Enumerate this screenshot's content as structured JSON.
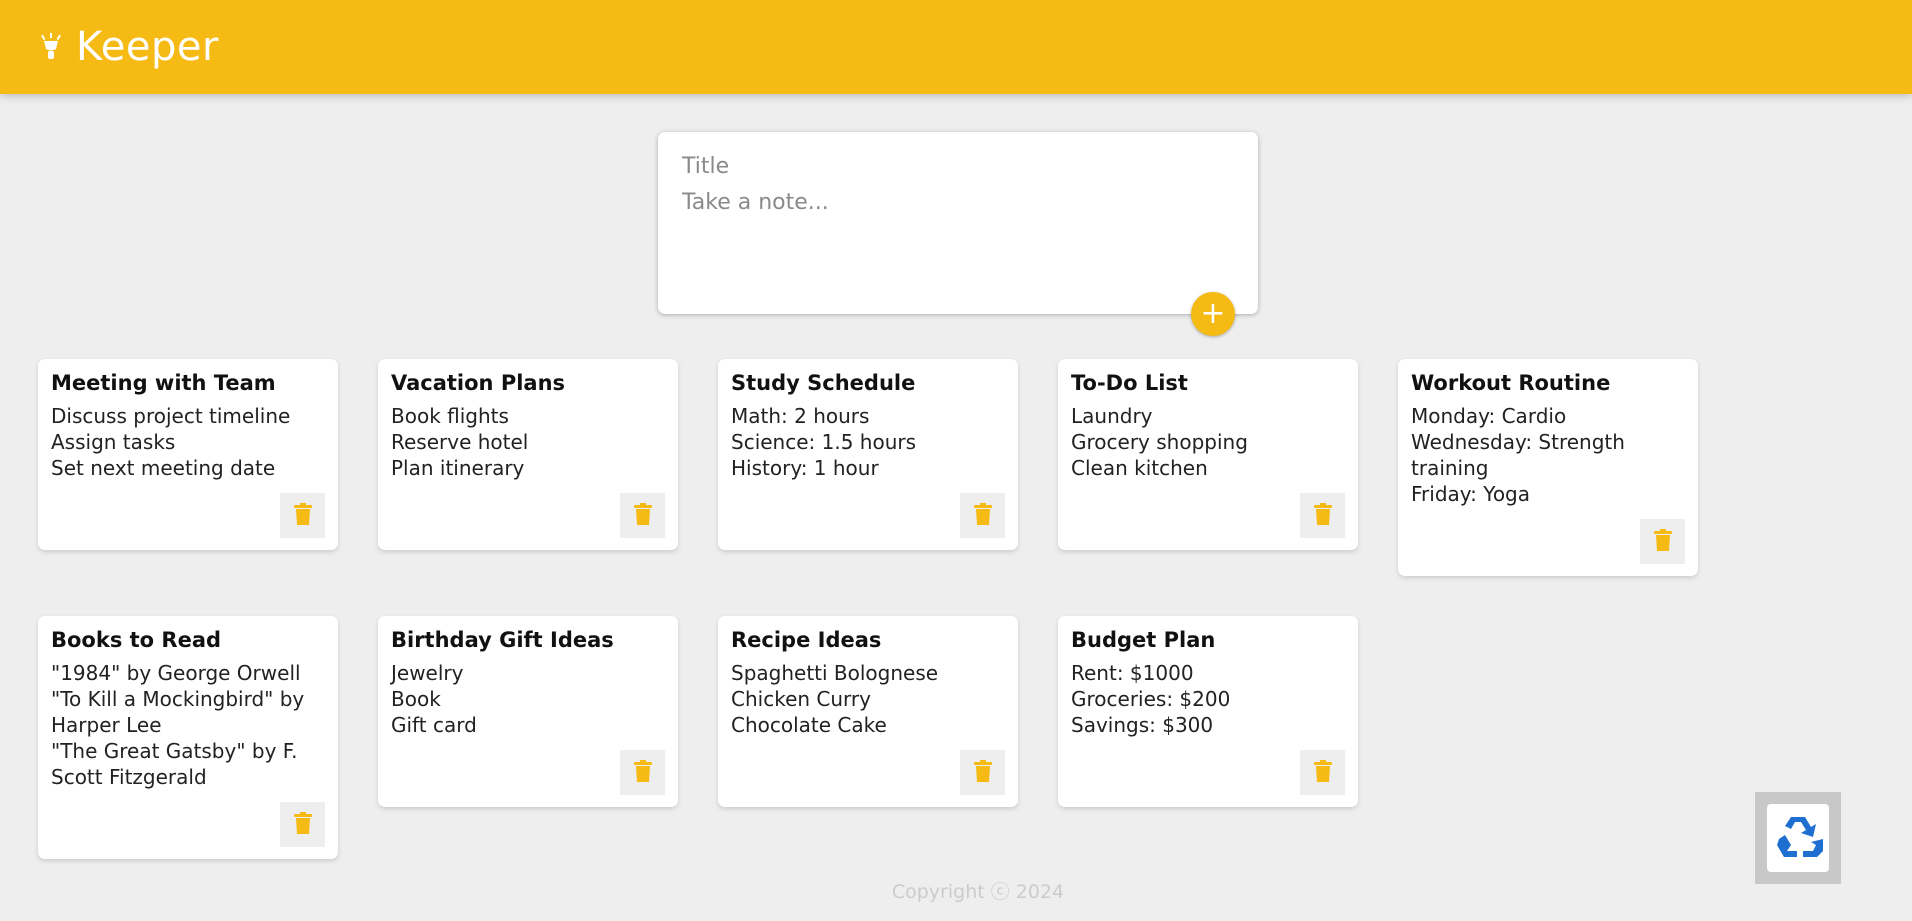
{
  "app": {
    "title": "Keeper"
  },
  "colors": {
    "accent": "#f5ba13",
    "recycle": "#1e6fd0"
  },
  "compose": {
    "title_placeholder": "Title",
    "content_placeholder": "Take a note...",
    "add_label": "+"
  },
  "notes": [
    {
      "title": "Meeting with Team",
      "lines": [
        "Discuss project timeline",
        "Assign tasks",
        "Set next meeting date"
      ]
    },
    {
      "title": "Vacation Plans",
      "lines": [
        "Book flights",
        "Reserve hotel",
        "Plan itinerary"
      ]
    },
    {
      "title": "Study Schedule",
      "lines": [
        "Math: 2 hours",
        "Science: 1.5 hours",
        "History: 1 hour"
      ]
    },
    {
      "title": "To-Do List",
      "lines": [
        "Laundry",
        "Grocery shopping",
        "Clean kitchen"
      ]
    },
    {
      "title": "Workout Routine",
      "lines": [
        "Monday: Cardio",
        "Wednesday: Strength training",
        "Friday: Yoga"
      ]
    },
    {
      "title": "Books to Read",
      "lines": [
        "\"1984\" by George Orwell",
        "\"To Kill a Mockingbird\" by Harper Lee",
        "\"The Great Gatsby\" by F. Scott Fitzgerald"
      ]
    },
    {
      "title": "Birthday Gift Ideas",
      "lines": [
        "Jewelry",
        "Book",
        "Gift card"
      ]
    },
    {
      "title": "Recipe Ideas",
      "lines": [
        "Spaghetti Bolognese",
        "Chicken Curry",
        "Chocolate Cake"
      ]
    },
    {
      "title": "Budget Plan",
      "lines": [
        "Rent: $1000",
        "Groceries: $200",
        "Savings: $300"
      ]
    }
  ],
  "footer": {
    "text": "Copyright ⓒ 2024"
  }
}
